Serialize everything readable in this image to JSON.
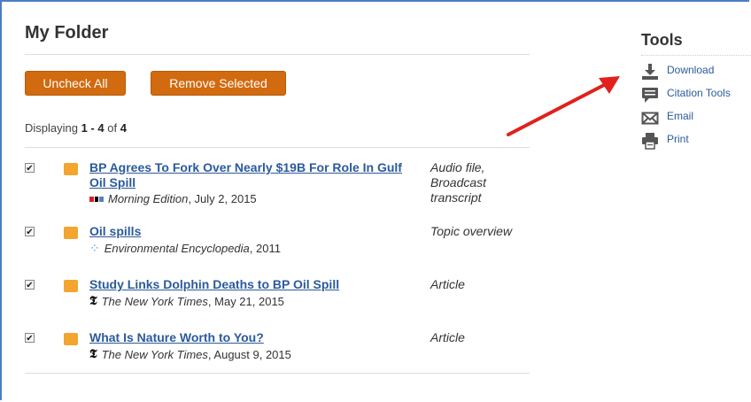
{
  "folder": {
    "title": "My Folder",
    "uncheck_label": "Uncheck All",
    "remove_label": "Remove Selected",
    "displaying_prefix": "Displaying ",
    "displaying_range": "1 - 4",
    "displaying_of": " of ",
    "displaying_total": "4"
  },
  "items": [
    {
      "title": "BP Agrees To Fork Over Nearly $19B For Role In Gulf Oil Spill",
      "source_name": "Morning Edition",
      "source_date": ", July 2, 2015",
      "source_icon": "npr-logo-icon",
      "type": "Audio file, Broadcast transcript",
      "checked": true
    },
    {
      "title": "Oil spills",
      "source_name": "Environmental Encyclopedia",
      "source_date": ", 2011",
      "source_icon": "encyclopedia-logo-icon",
      "type": "Topic overview",
      "checked": true
    },
    {
      "title": "Study Links Dolphin Deaths to BP Oil Spill",
      "source_name": "The New York Times",
      "source_date": ", May 21, 2015",
      "source_icon": "nyt-logo-icon",
      "type": "Article",
      "checked": true
    },
    {
      "title": "What Is Nature Worth to You?",
      "source_name": "The New York Times",
      "source_date": ", August 9, 2015",
      "source_icon": "nyt-logo-icon",
      "type": "Article",
      "checked": true
    }
  ],
  "tools": {
    "title": "Tools",
    "download": "Download",
    "citation": "Citation Tools",
    "email": "Email",
    "print": "Print"
  },
  "colors": {
    "button_bg": "#d26a0f",
    "link": "#2b5a9b",
    "folder_icon": "#f3a530",
    "arrow": "#e0211c",
    "frame": "#4a7fc1"
  }
}
